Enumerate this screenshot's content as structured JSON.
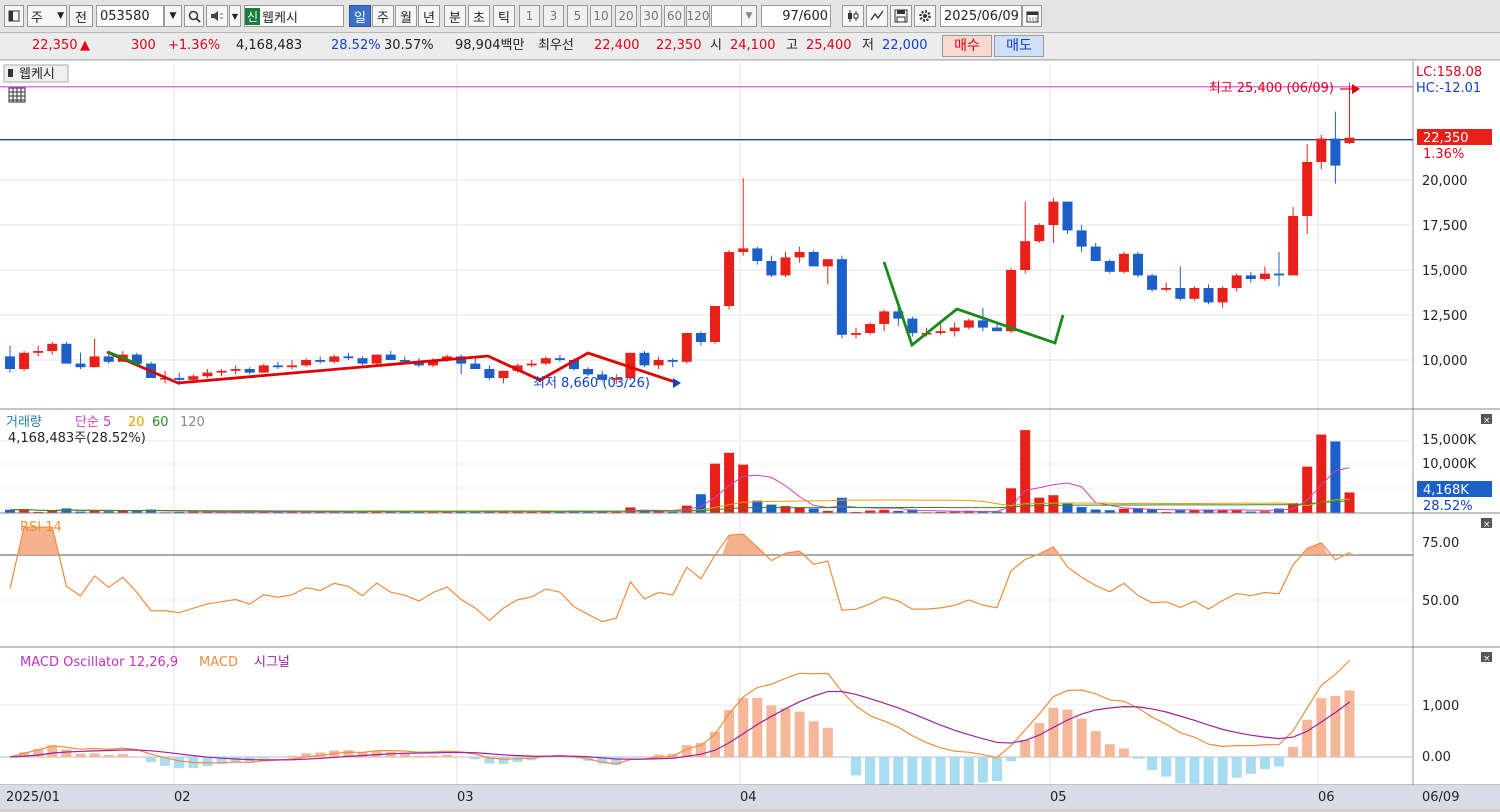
{
  "toolbar": {
    "period_type": "주",
    "prev_label": "전",
    "stock_code": "053580",
    "new_badge": "신",
    "stock_name": "웹케시",
    "periods": [
      "일",
      "주",
      "월",
      "년",
      "분",
      "초",
      "틱"
    ],
    "selected_period": "일",
    "intervals": [
      "1",
      "3",
      "5",
      "10",
      "20",
      "30",
      "60",
      "120"
    ],
    "count_value": "97",
    "count_max": "/600",
    "date": "2025/06/09"
  },
  "infobar": {
    "price": "22,350",
    "change_arrow": "▲",
    "change": "300",
    "change_pct": "+1.36%",
    "volume": "4,168,483",
    "turnover_pct": "28.52%",
    "ratio_pct": "30.57%",
    "amount": "98,904백만",
    "best_label": "최우선",
    "best_ask": "22,400",
    "best_bid": "22,350",
    "open_label": "시",
    "open": "24,100",
    "high_label": "고",
    "high": "25,400",
    "low_label": "저",
    "low": "22,000",
    "buy_label": "매수",
    "sell_label": "매도"
  },
  "price_panel": {
    "title": "웹케시",
    "max_label": "최고 25,400 (06/09)",
    "min_label": "최저 8,660 (03/26)",
    "lc_label": "LC:158.08",
    "hc_label": "HC:-12.01",
    "current_price": "22,350",
    "current_pct": "1.36%",
    "y_ticks": [
      "20,000",
      "17,500",
      "15,000",
      "12,500",
      "10,000"
    ]
  },
  "volume_panel": {
    "title": "거래량",
    "ma_label": "단순 5",
    "ma_20": "20",
    "ma_60": "60",
    "ma_120": "120",
    "value_line": "4,168,483주(28.52%)",
    "y_ticks": [
      "15,000K",
      "10,000K",
      "5,000K"
    ],
    "current_value": "4,168K",
    "current_pct": "28.52%"
  },
  "rsi_panel": {
    "title": "RSI 14",
    "y_ticks": [
      "75.00",
      "50.00"
    ]
  },
  "macd_panel": {
    "title": "MACD Oscillator 12,26,9",
    "macd_label": "MACD",
    "signal_label": "시그널",
    "y_ticks": [
      "1,000",
      "0.00"
    ]
  },
  "x_axis": {
    "labels": [
      "2025/01",
      "02",
      "03",
      "04",
      "05",
      "06",
      "06/09"
    ]
  },
  "colors": {
    "up": "#e8201a",
    "down": "#1c5fc8",
    "ma5": "#d040c0",
    "ma20": "#e8a000",
    "ma60": "#2a8a2a",
    "rsi": "#f08c3c",
    "macd": "#f08c3c",
    "signal": "#a020a0",
    "osc_pos": "#f5b79a",
    "osc_neg": "#a8dcf0"
  },
  "chart_data": {
    "type": "candlestick",
    "note_unit": "KRW",
    "candles": [
      [
        10200,
        10800,
        9300,
        9500
      ],
      [
        9500,
        10500,
        9400,
        10400
      ],
      [
        10400,
        10800,
        10200,
        10500
      ],
      [
        10500,
        11000,
        10300,
        10900
      ],
      [
        10900,
        11000,
        9800,
        9800
      ],
      [
        9800,
        10400,
        9500,
        9600
      ],
      [
        9600,
        11200,
        9600,
        10200
      ],
      [
        10200,
        10400,
        9800,
        9900
      ],
      [
        9900,
        10500,
        9900,
        10300
      ],
      [
        10300,
        10400,
        9700,
        9800
      ],
      [
        9800,
        9900,
        9000,
        9000
      ],
      [
        9000,
        9400,
        8700,
        9000
      ],
      [
        9000,
        9300,
        8600,
        8900
      ],
      [
        8900,
        9200,
        8700,
        9100
      ],
      [
        9100,
        9500,
        9000,
        9300
      ],
      [
        9300,
        9500,
        9100,
        9400
      ],
      [
        9400,
        9700,
        9200,
        9500
      ],
      [
        9500,
        9600,
        9200,
        9300
      ],
      [
        9300,
        9800,
        9300,
        9700
      ],
      [
        9700,
        9900,
        9500,
        9600
      ],
      [
        9600,
        10000,
        9500,
        9700
      ],
      [
        9700,
        10100,
        9600,
        10000
      ],
      [
        10000,
        10200,
        9800,
        9900
      ],
      [
        9900,
        10300,
        9800,
        10200
      ],
      [
        10200,
        10400,
        10000,
        10100
      ],
      [
        10100,
        10200,
        9700,
        9800
      ],
      [
        9800,
        10300,
        9700,
        10300
      ],
      [
        10300,
        10500,
        10000,
        10000
      ],
      [
        10000,
        10200,
        9800,
        9900
      ],
      [
        9900,
        10100,
        9600,
        9700
      ],
      [
        9700,
        10100,
        9600,
        10000
      ],
      [
        10000,
        10300,
        9900,
        10200
      ],
      [
        10200,
        10300,
        9200,
        9800
      ],
      [
        9800,
        10200,
        9600,
        9500
      ],
      [
        9500,
        9700,
        8900,
        9000
      ],
      [
        9000,
        9400,
        8700,
        9400
      ],
      [
        9400,
        9800,
        9300,
        9700
      ],
      [
        9700,
        10000,
        9600,
        9800
      ],
      [
        9800,
        10200,
        9700,
        10100
      ],
      [
        10100,
        10300,
        9900,
        10000
      ],
      [
        10000,
        10100,
        9400,
        9500
      ],
      [
        9500,
        9600,
        9100,
        9200
      ],
      [
        9200,
        9400,
        8800,
        8900
      ],
      [
        8900,
        9200,
        8660,
        9000
      ],
      [
        9000,
        10400,
        8900,
        10400
      ],
      [
        10400,
        10500,
        9600,
        9700
      ],
      [
        9700,
        10200,
        9500,
        10000
      ],
      [
        10000,
        10100,
        9600,
        9900
      ],
      [
        9900,
        11500,
        9800,
        11500
      ],
      [
        11500,
        11600,
        10800,
        11000
      ],
      [
        11000,
        13000,
        10900,
        13000
      ],
      [
        13000,
        16100,
        12800,
        16000
      ],
      [
        16000,
        20100,
        15800,
        16200
      ],
      [
        16200,
        16300,
        15300,
        15500
      ],
      [
        15500,
        15800,
        14600,
        14700
      ],
      [
        14700,
        16000,
        14600,
        15700
      ],
      [
        15700,
        16300,
        15400,
        16000
      ],
      [
        16000,
        16100,
        15300,
        15200
      ],
      [
        15200,
        15600,
        14200,
        15600
      ],
      [
        15600,
        15800,
        11200,
        11400
      ],
      [
        11400,
        11800,
        11200,
        11500
      ],
      [
        11500,
        12100,
        11400,
        12000
      ],
      [
        12000,
        12800,
        11600,
        12700
      ],
      [
        12700,
        12900,
        11900,
        12300
      ],
      [
        12300,
        12400,
        11300,
        11500
      ],
      [
        11500,
        11800,
        11300,
        11500
      ],
      [
        11500,
        12000,
        11400,
        11600
      ],
      [
        11600,
        12100,
        11300,
        11800
      ],
      [
        11800,
        12300,
        11700,
        12200
      ],
      [
        12200,
        12900,
        11600,
        11800
      ],
      [
        11800,
        12000,
        11600,
        11600
      ],
      [
        11600,
        15100,
        11500,
        15000
      ],
      [
        15000,
        18800,
        14800,
        16600
      ],
      [
        16600,
        17600,
        16500,
        17500
      ],
      [
        17500,
        19000,
        16500,
        18800
      ],
      [
        18800,
        18800,
        17000,
        17200
      ],
      [
        17200,
        17500,
        16000,
        16300
      ],
      [
        16300,
        16500,
        15500,
        15500
      ],
      [
        15500,
        15600,
        14800,
        14900
      ],
      [
        14900,
        16000,
        14800,
        15900
      ],
      [
        15900,
        16000,
        14600,
        14700
      ],
      [
        14700,
        14800,
        13800,
        13900
      ],
      [
        13900,
        14300,
        13800,
        14000
      ],
      [
        14000,
        15200,
        13300,
        13400
      ],
      [
        13400,
        14100,
        13300,
        14000
      ],
      [
        14000,
        14200,
        13100,
        13200
      ],
      [
        13200,
        14100,
        12900,
        14000
      ],
      [
        14000,
        14800,
        13800,
        14700
      ],
      [
        14700,
        14900,
        14300,
        14500
      ],
      [
        14500,
        15200,
        14400,
        14800
      ],
      [
        14800,
        16000,
        14100,
        14700
      ],
      [
        14700,
        18500,
        14700,
        18000
      ],
      [
        18000,
        22000,
        17000,
        21000
      ],
      [
        21000,
        22500,
        20600,
        22300
      ],
      [
        22300,
        23800,
        19800,
        20800
      ],
      [
        22050,
        25400,
        22000,
        22350
      ]
    ]
  }
}
